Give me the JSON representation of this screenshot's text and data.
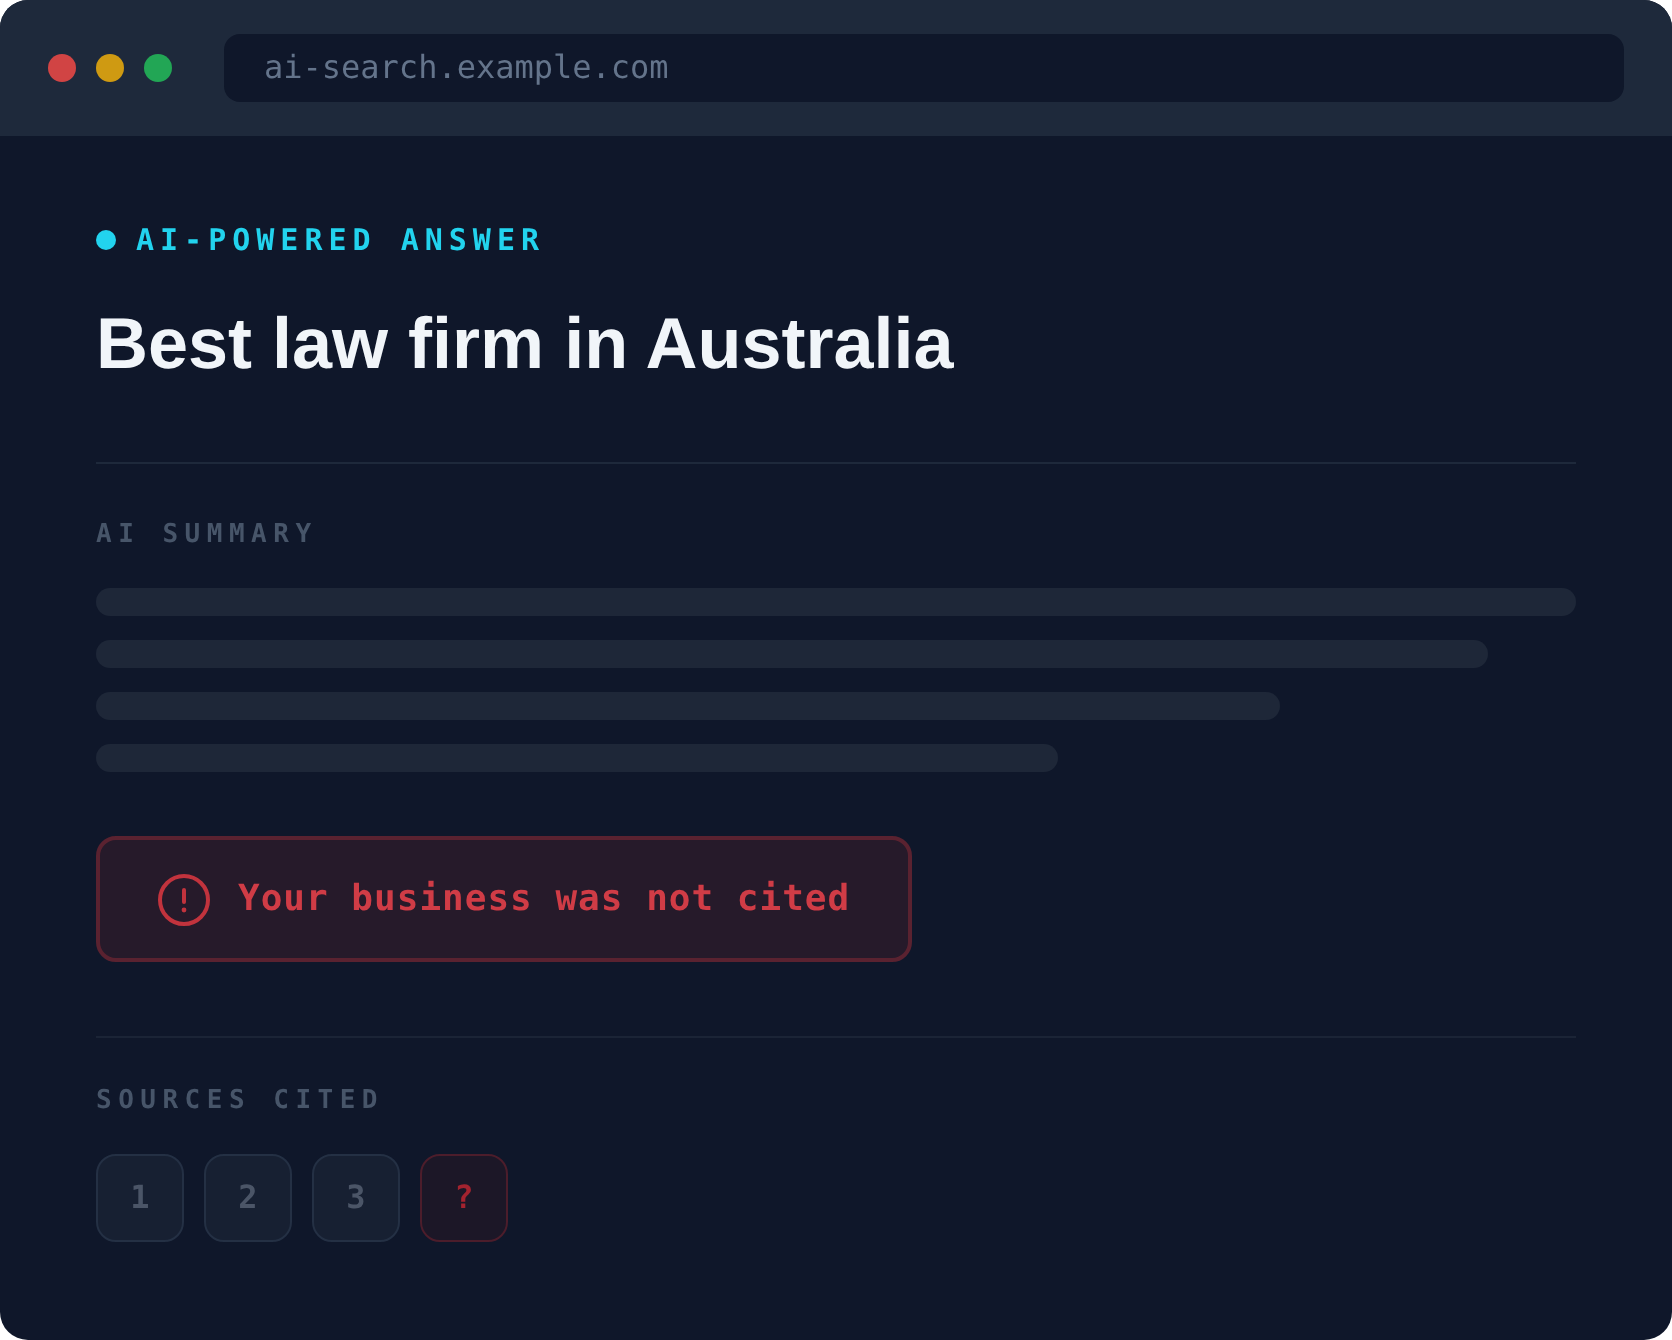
{
  "browser": {
    "url": "ai-search.example.com"
  },
  "answer": {
    "badge": "AI-POWERED ANSWER",
    "query": "Best law firm in Australia"
  },
  "summary": {
    "heading": "AI SUMMARY"
  },
  "alert": {
    "text": "Your business was not cited"
  },
  "sources": {
    "heading": "SOURCES CITED",
    "items": [
      {
        "label": "1",
        "cited": true
      },
      {
        "label": "2",
        "cited": true
      },
      {
        "label": "3",
        "cited": true
      },
      {
        "label": "?",
        "cited": false
      }
    ]
  }
}
